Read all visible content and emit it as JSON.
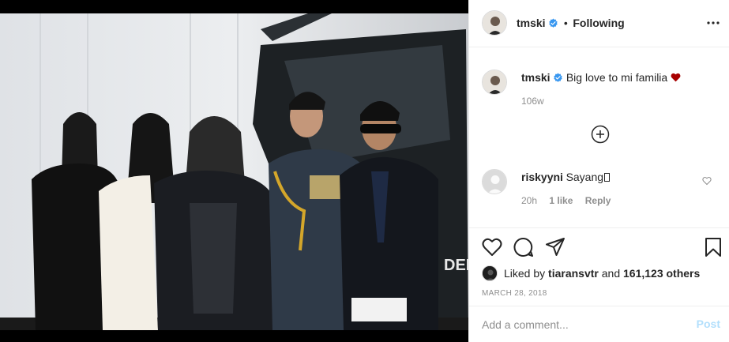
{
  "header": {
    "username": "tmski",
    "separator": "•",
    "follow_status": "Following",
    "more_icon": "more-horizontal-icon"
  },
  "caption": {
    "username": "tmski",
    "text": "Big love to mi familia",
    "emoji": "heart-emoji",
    "age": "106w"
  },
  "load_more": {
    "icon": "plus-circle-icon"
  },
  "comments": [
    {
      "username": "riskyyni",
      "text": "Sayang",
      "text_suffix": "",
      "age": "20h",
      "likes": "1 like",
      "reply_label": "Reply"
    }
  ],
  "actions": {
    "like_icon": "heart-outline-icon",
    "comment_icon": "comment-icon",
    "share_icon": "share-icon",
    "save_icon": "bookmark-icon"
  },
  "likes": {
    "prefix": "Liked by",
    "user": "tiaransvtr",
    "conjunction": "and",
    "others": "161,123 others"
  },
  "post_date": "MARCH 28, 2018",
  "add_comment": {
    "placeholder": "Add a comment...",
    "post_label": "Post"
  },
  "colors": {
    "verified": "#3897f0",
    "post_disabled": "#b2dffc",
    "heart": "#a80000"
  }
}
